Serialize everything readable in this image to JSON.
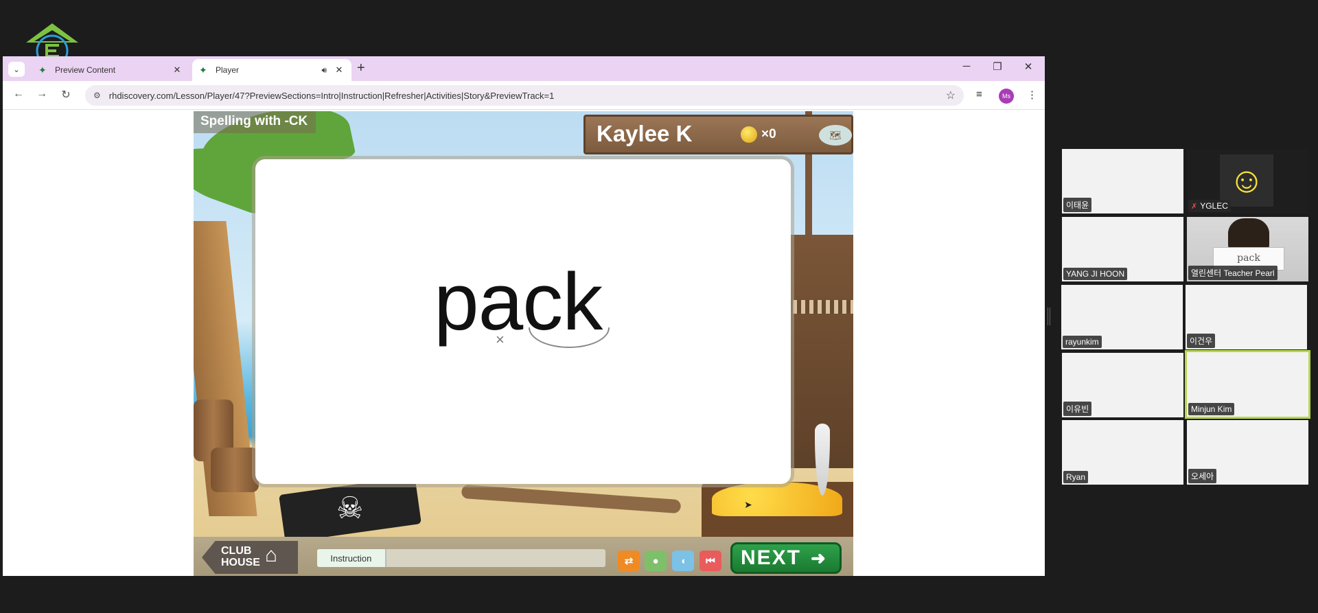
{
  "browser": {
    "tabs": [
      {
        "title": "Preview Content",
        "active": false
      },
      {
        "title": "Player",
        "active": true
      }
    ],
    "url": "rhdiscovery.com/Lesson/Player/47?PreviewSections=Intro|Instruction|Refresher|Activities|Story&PreviewTrack=1",
    "profile_initials": "Ms"
  },
  "game": {
    "lesson_title": "Spelling with -CK",
    "student_name": "Kaylee K",
    "coin_count": "×0",
    "word": "pack",
    "mark": "×",
    "clubhouse_label_1": "CLUB",
    "clubhouse_label_2": "HOUSE",
    "progress_label": "Instruction",
    "progress_fraction": 0.24,
    "next_label": "NEXT",
    "accent_colors": {
      "next": "#1a7a31",
      "coin": "#e0a514",
      "ctrl_orange": "#f08a24",
      "ctrl_green": "#7ec06a",
      "ctrl_blue": "#7cc1e6",
      "ctrl_red": "#ea5b5b"
    }
  },
  "participants": [
    {
      "name": "이태윤",
      "muted": false,
      "highlight": false
    },
    {
      "name": "YGLEC",
      "muted": true,
      "highlight": false
    },
    {
      "name": "YANG JI HOON",
      "muted": false,
      "highlight": false
    },
    {
      "name": "열린센터 Teacher Pearl",
      "muted": false,
      "highlight": false
    },
    {
      "name": "rayunkim",
      "muted": false,
      "highlight": false
    },
    {
      "name": "이건우",
      "muted": false,
      "highlight": false
    },
    {
      "name": "이유빈",
      "muted": false,
      "highlight": false
    },
    {
      "name": "Minjun Kim",
      "muted": false,
      "highlight": true
    },
    {
      "name": "Ryan",
      "muted": false,
      "highlight": false
    },
    {
      "name": "오세아",
      "muted": false,
      "highlight": false
    }
  ],
  "teacher_card_text": "pack"
}
